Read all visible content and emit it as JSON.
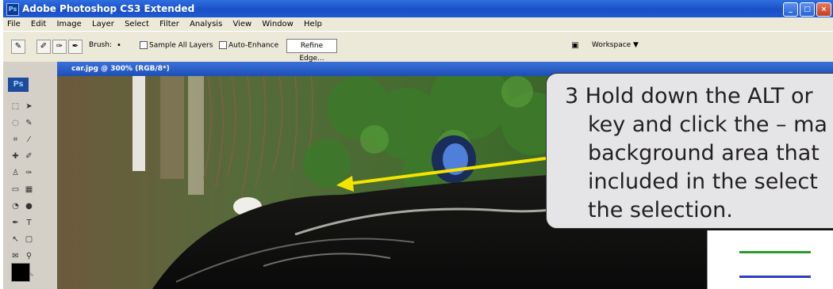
{
  "window": {
    "title": "Adobe Photoshop CS3 Extended",
    "controls": {
      "minimize": "_",
      "maximize": "□",
      "close": "×"
    }
  },
  "menubar": {
    "items": [
      "File",
      "Edit",
      "Image",
      "Layer",
      "Select",
      "Filter",
      "Analysis",
      "View",
      "Window",
      "Help"
    ]
  },
  "options_bar": {
    "brush_label": "Brush:",
    "sample_all_layers": "Sample All Layers",
    "auto_enhance": "Auto-Enhance",
    "refine_edge": "Refine Edge...",
    "workspace": "Workspace ▼"
  },
  "toolbox": {
    "logo": "Ps"
  },
  "document": {
    "title": "car.jpg @ 300% (RGB/8*)"
  },
  "callout": {
    "lines": [
      "3 Hold down the ALT or",
      "key and click the – ma",
      "background area that",
      "included in the select",
      "the selection."
    ]
  },
  "colors": {
    "callout_bg": "#e5e5e7",
    "arrow": "#f5e400",
    "titlebar": "#1f59d0"
  }
}
